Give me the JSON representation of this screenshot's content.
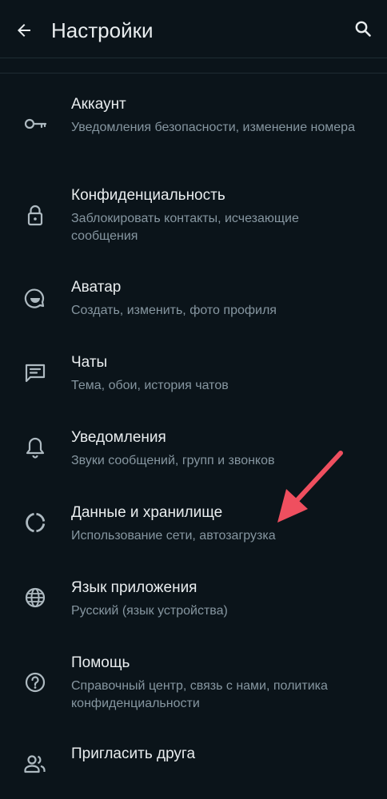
{
  "header": {
    "title": "Настройки",
    "back_icon": "arrow-left-icon",
    "search_icon": "search-icon"
  },
  "colors": {
    "background": "#0b141a",
    "primary_text": "#e9edef",
    "secondary_text": "#8696a0",
    "icon": "#aebac1",
    "annotation_arrow": "#ef4f5f"
  },
  "settings": {
    "items": [
      {
        "title": "Аккаунт",
        "subtitle": "Уведомления безопасности, изменение номера",
        "icon": "key-icon"
      },
      {
        "title": "Конфиденциальность",
        "subtitle": "Заблокировать контакты, исчезающие сообщения",
        "icon": "lock-icon"
      },
      {
        "title": "Аватар",
        "subtitle": "Создать, изменить, фото профиля",
        "icon": "avatar-icon"
      },
      {
        "title": "Чаты",
        "subtitle": "Тема, обои, история чатов",
        "icon": "chat-icon"
      },
      {
        "title": "Уведомления",
        "subtitle": "Звуки сообщений, групп и звонков",
        "icon": "bell-icon"
      },
      {
        "title": "Данные и хранилище",
        "subtitle": "Использование сети, автозагрузка",
        "icon": "data-usage-icon"
      },
      {
        "title": "Язык приложения",
        "subtitle": "Русский (язык устройства)",
        "icon": "globe-icon"
      },
      {
        "title": "Помощь",
        "subtitle": "Справочный центр, связь с нами, политика конфиденциальности",
        "icon": "help-icon"
      },
      {
        "title": "Пригласить друга",
        "subtitle": "",
        "icon": "people-icon"
      }
    ]
  }
}
